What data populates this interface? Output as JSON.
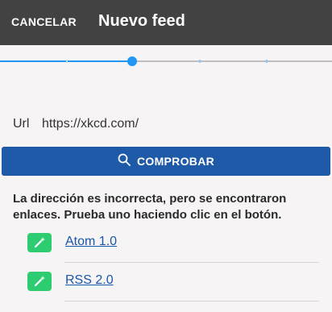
{
  "appbar": {
    "cancel_label": "CANCELAR",
    "title": "Nuevo feed"
  },
  "stepper": {
    "step_count": 5,
    "current_step": 3,
    "active_color": "#2196f3",
    "inactive_color": "#bdbdbd"
  },
  "url_field": {
    "label": "Url",
    "value": "https://xkcd.com/"
  },
  "check_button": {
    "label": "COMPROBAR",
    "icon": "search-icon",
    "color": "#1e5aa8"
  },
  "message": "La dirección es incorrecta, pero se encontraron enlaces. Prueba uno haciendo clic en el botón.",
  "feeds": [
    {
      "label": "Atom 1.0",
      "icon": "magic-wand-icon"
    },
    {
      "label": "RSS 2.0",
      "icon": "magic-wand-icon"
    }
  ],
  "colors": {
    "appbar": "#424242",
    "background": "#f6f4f4",
    "feed_icon": "#2ecc71",
    "link": "#1a57a8"
  }
}
